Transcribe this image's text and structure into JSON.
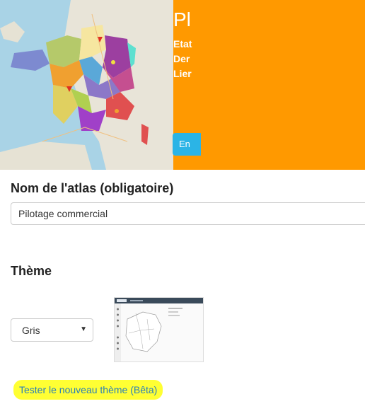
{
  "banner": {
    "title": "Pl",
    "info_lines": [
      "Etat",
      "Der",
      "Lier"
    ],
    "button_label": "En",
    "accent_color": "#ff9900",
    "button_color": "#2bb4e6"
  },
  "form": {
    "name_label": "Nom de l'atlas (obligatoire)",
    "name_value": "Pilotage commercial",
    "theme_label": "Thème",
    "theme_selected": "Gris",
    "test_theme_link": "Tester le nouveau thème (Bêta)"
  },
  "icons": {
    "select_caret": "▼"
  }
}
